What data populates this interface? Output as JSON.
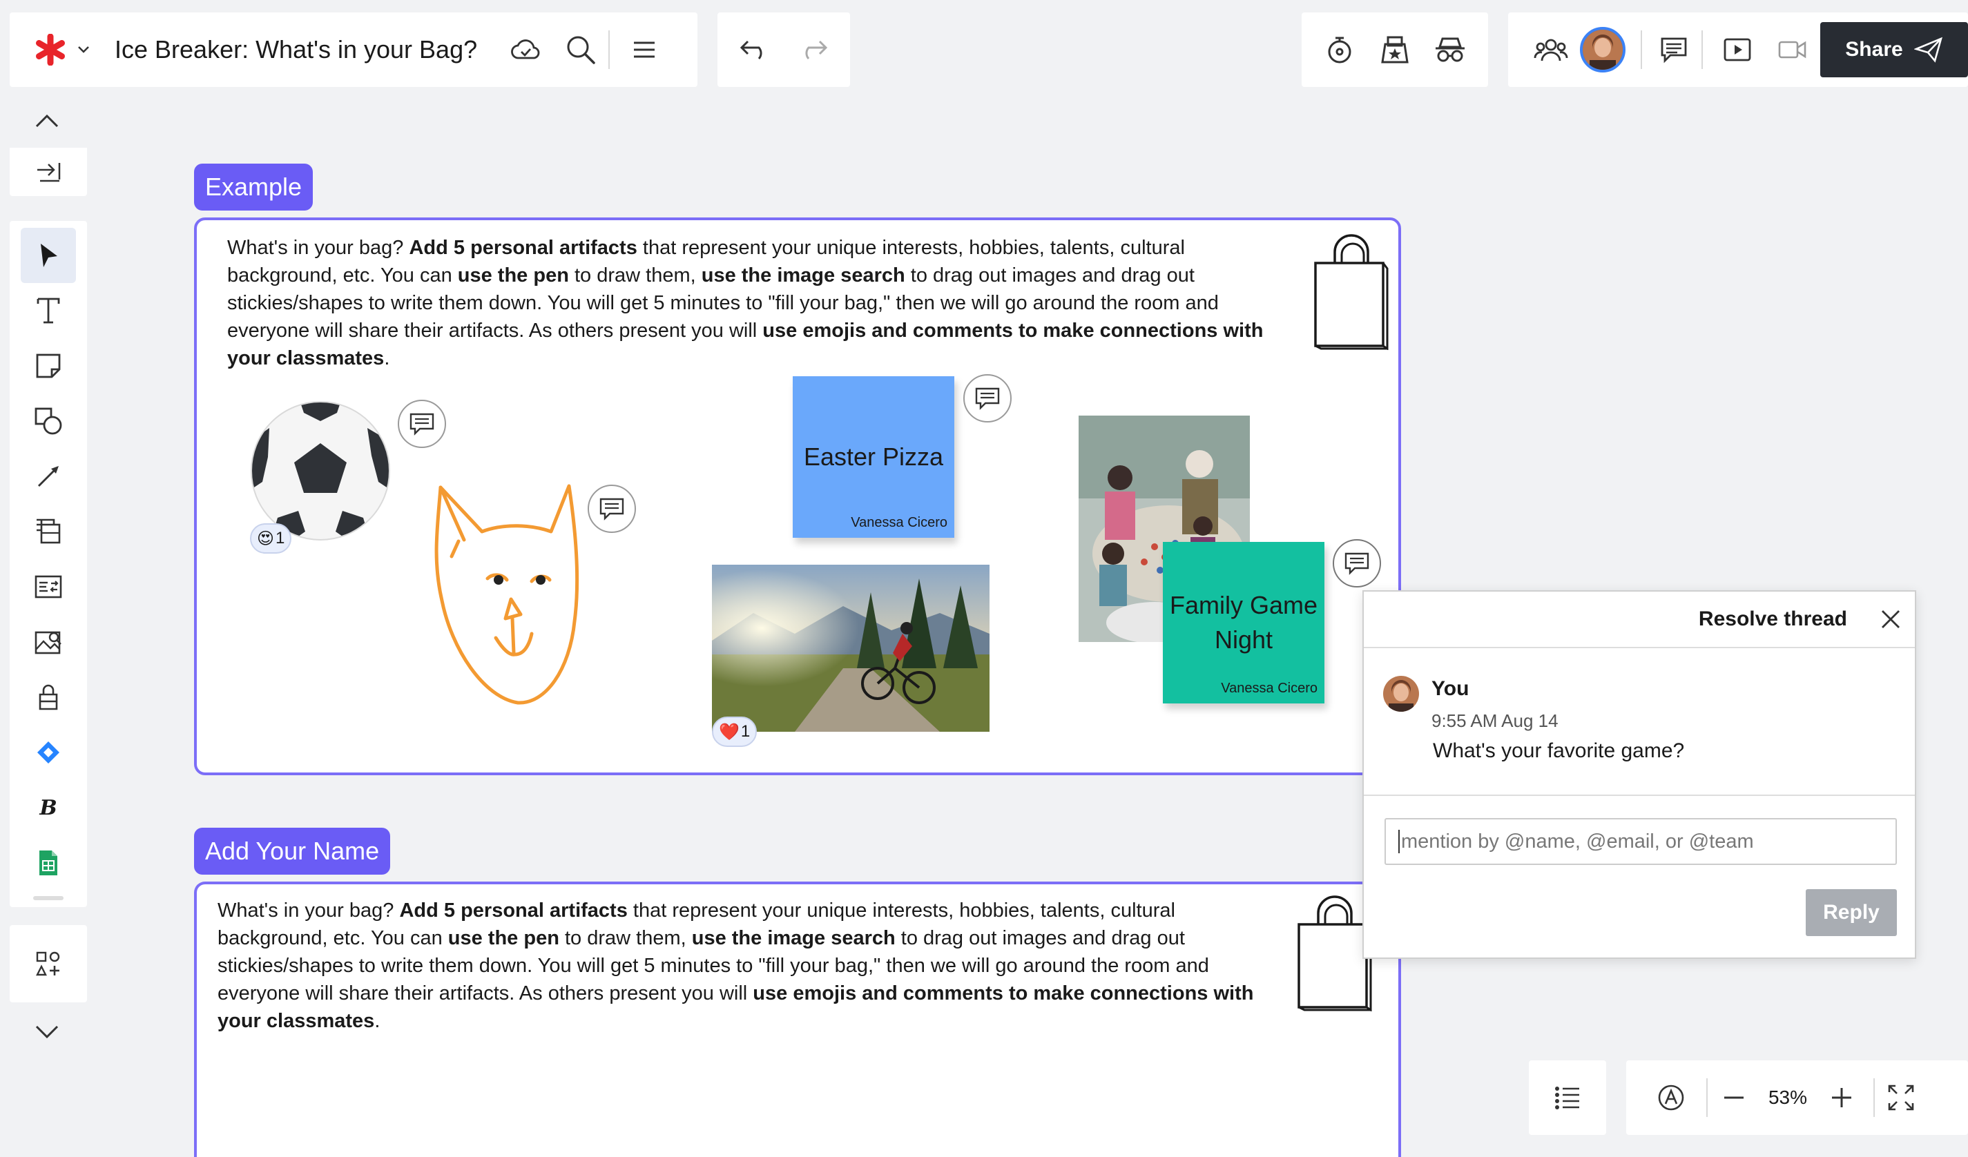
{
  "app": {
    "title": "Ice Breaker: What's in your Bag?",
    "logo_color": "#e8242a"
  },
  "header": {
    "share_label": "Share"
  },
  "frames": [
    {
      "label": "Example",
      "text_plain_1": "What's in your bag? ",
      "text_bold_1": "Add 5 personal artifacts",
      "text_plain_2": " that represent your unique interests, hobbies, talents, cultural background, etc. You can ",
      "text_bold_2": "use the pen",
      "text_plain_3": " to draw them, ",
      "text_bold_3": "use the image search",
      "text_plain_4": " to drag out images and drag out stickies/shapes to write them down. You will get 5 minutes to \"fill your bag,\" then we will go around the room and everyone will share their artifacts. As others present you will ",
      "text_bold_4": "use emojis and comments to make connections with your classmates",
      "text_plain_5": "."
    },
    {
      "label": "Add Your Name",
      "text_plain_1": "What's in your bag? ",
      "text_bold_1": "Add 5 personal artifacts",
      "text_plain_2": " that represent your unique interests, hobbies, talents, cultural background, etc. You can ",
      "text_bold_2": "use the pen",
      "text_plain_3": " to draw them, ",
      "text_bold_3": "use the image search",
      "text_plain_4": " to drag out images and drag out stickies/shapes to write them down. You will get 5 minutes to \"fill your bag,\" then we will go around the room and everyone will share their artifacts. As others present you will ",
      "text_bold_4": "use emojis and comments to make connections with your classmates",
      "text_plain_5": "."
    }
  ],
  "stickies": [
    {
      "text": "Easter Pizza",
      "author": "Vanessa Cicero",
      "color": "#6aa8fb"
    },
    {
      "text": "Family Game Night",
      "author": "Vanessa Cicero",
      "color": "#13c0a0"
    }
  ],
  "reactions": [
    {
      "emoji": "😍",
      "count": "1"
    },
    {
      "emoji": "❤️",
      "count": "1"
    }
  ],
  "thread": {
    "title": "Resolve thread",
    "author": "You",
    "time": "9:55 AM Aug 14",
    "message": "What's your favorite game?",
    "reply_placeholder": "mention by @name, @email, or @team",
    "reply_label": "Reply"
  },
  "zoom": {
    "level": "53%"
  }
}
